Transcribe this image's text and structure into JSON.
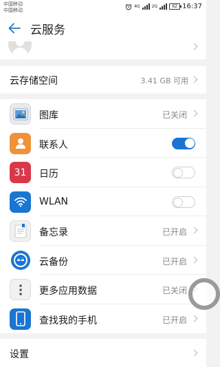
{
  "status_bar": {
    "carrier1": "中国移动",
    "carrier2": "中国移动",
    "net_4g": "4G",
    "net_2g": "2G",
    "battery": "62",
    "time": "16:37"
  },
  "header": {
    "title": "云服务"
  },
  "storage": {
    "label": "云存储空间",
    "value": "3.41 GB 可用"
  },
  "items": [
    {
      "name": "图库",
      "state": "已关闭",
      "type": "status"
    },
    {
      "name": "联系人",
      "type": "toggle",
      "on": true
    },
    {
      "name": "日历",
      "type": "toggle",
      "on": false,
      "icon_text": "31"
    },
    {
      "name": "WLAN",
      "type": "toggle",
      "on": false
    },
    {
      "name": "备忘录",
      "state": "已开启",
      "type": "status"
    },
    {
      "name": "云备份",
      "state": "已开启",
      "type": "status"
    },
    {
      "name": "更多应用数据",
      "state": "已关闭",
      "type": "status"
    },
    {
      "name": "查找我的手机",
      "state": "已开启",
      "type": "status"
    }
  ],
  "settings": {
    "label": "设置"
  },
  "colors": {
    "accent": "#1a75d2",
    "contacts_icon": "#f0923a",
    "calendar_icon": "#d9384a",
    "wlan_icon": "#1976d2",
    "findphone_icon": "#1976d2"
  }
}
